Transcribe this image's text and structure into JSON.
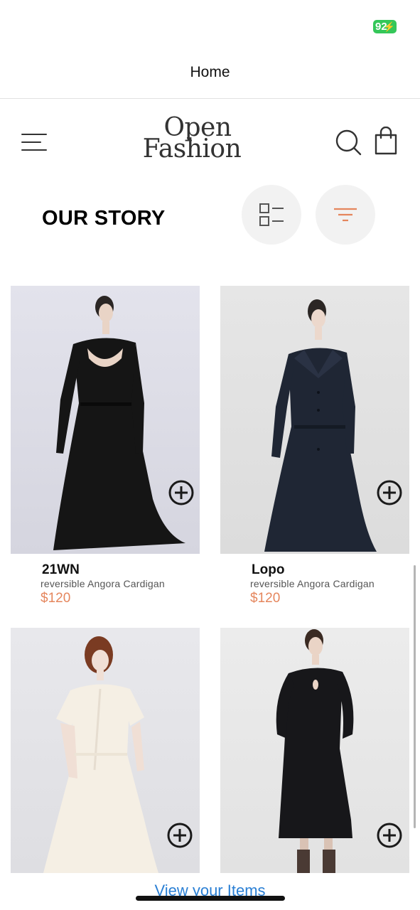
{
  "status_bar": {
    "battery_level": "92"
  },
  "nav": {
    "title": "Home"
  },
  "header": {
    "logo_line1": "Open",
    "logo_line2": "Fashion",
    "menu_icon": "hamburger-menu-icon",
    "search_icon": "search-icon",
    "bag_icon": "shopping-bag-icon"
  },
  "section": {
    "title": "OUR STORY",
    "list_view_icon": "list-view-icon",
    "filter_icon": "filter-icon"
  },
  "colors": {
    "accent": "#e5865d",
    "link": "#2a7fd4",
    "battery": "#34c759"
  },
  "products": [
    {
      "name": "21WN",
      "description": "reversible Angora Cardigan",
      "price": "$120"
    },
    {
      "name": "Lopo",
      "description": "reversible Angora Cardigan",
      "price": "$120"
    },
    {
      "name": "",
      "description": "",
      "price": ""
    },
    {
      "name": "",
      "description": "",
      "price": ""
    }
  ],
  "footer": {
    "view_items_label": "View your Items"
  }
}
